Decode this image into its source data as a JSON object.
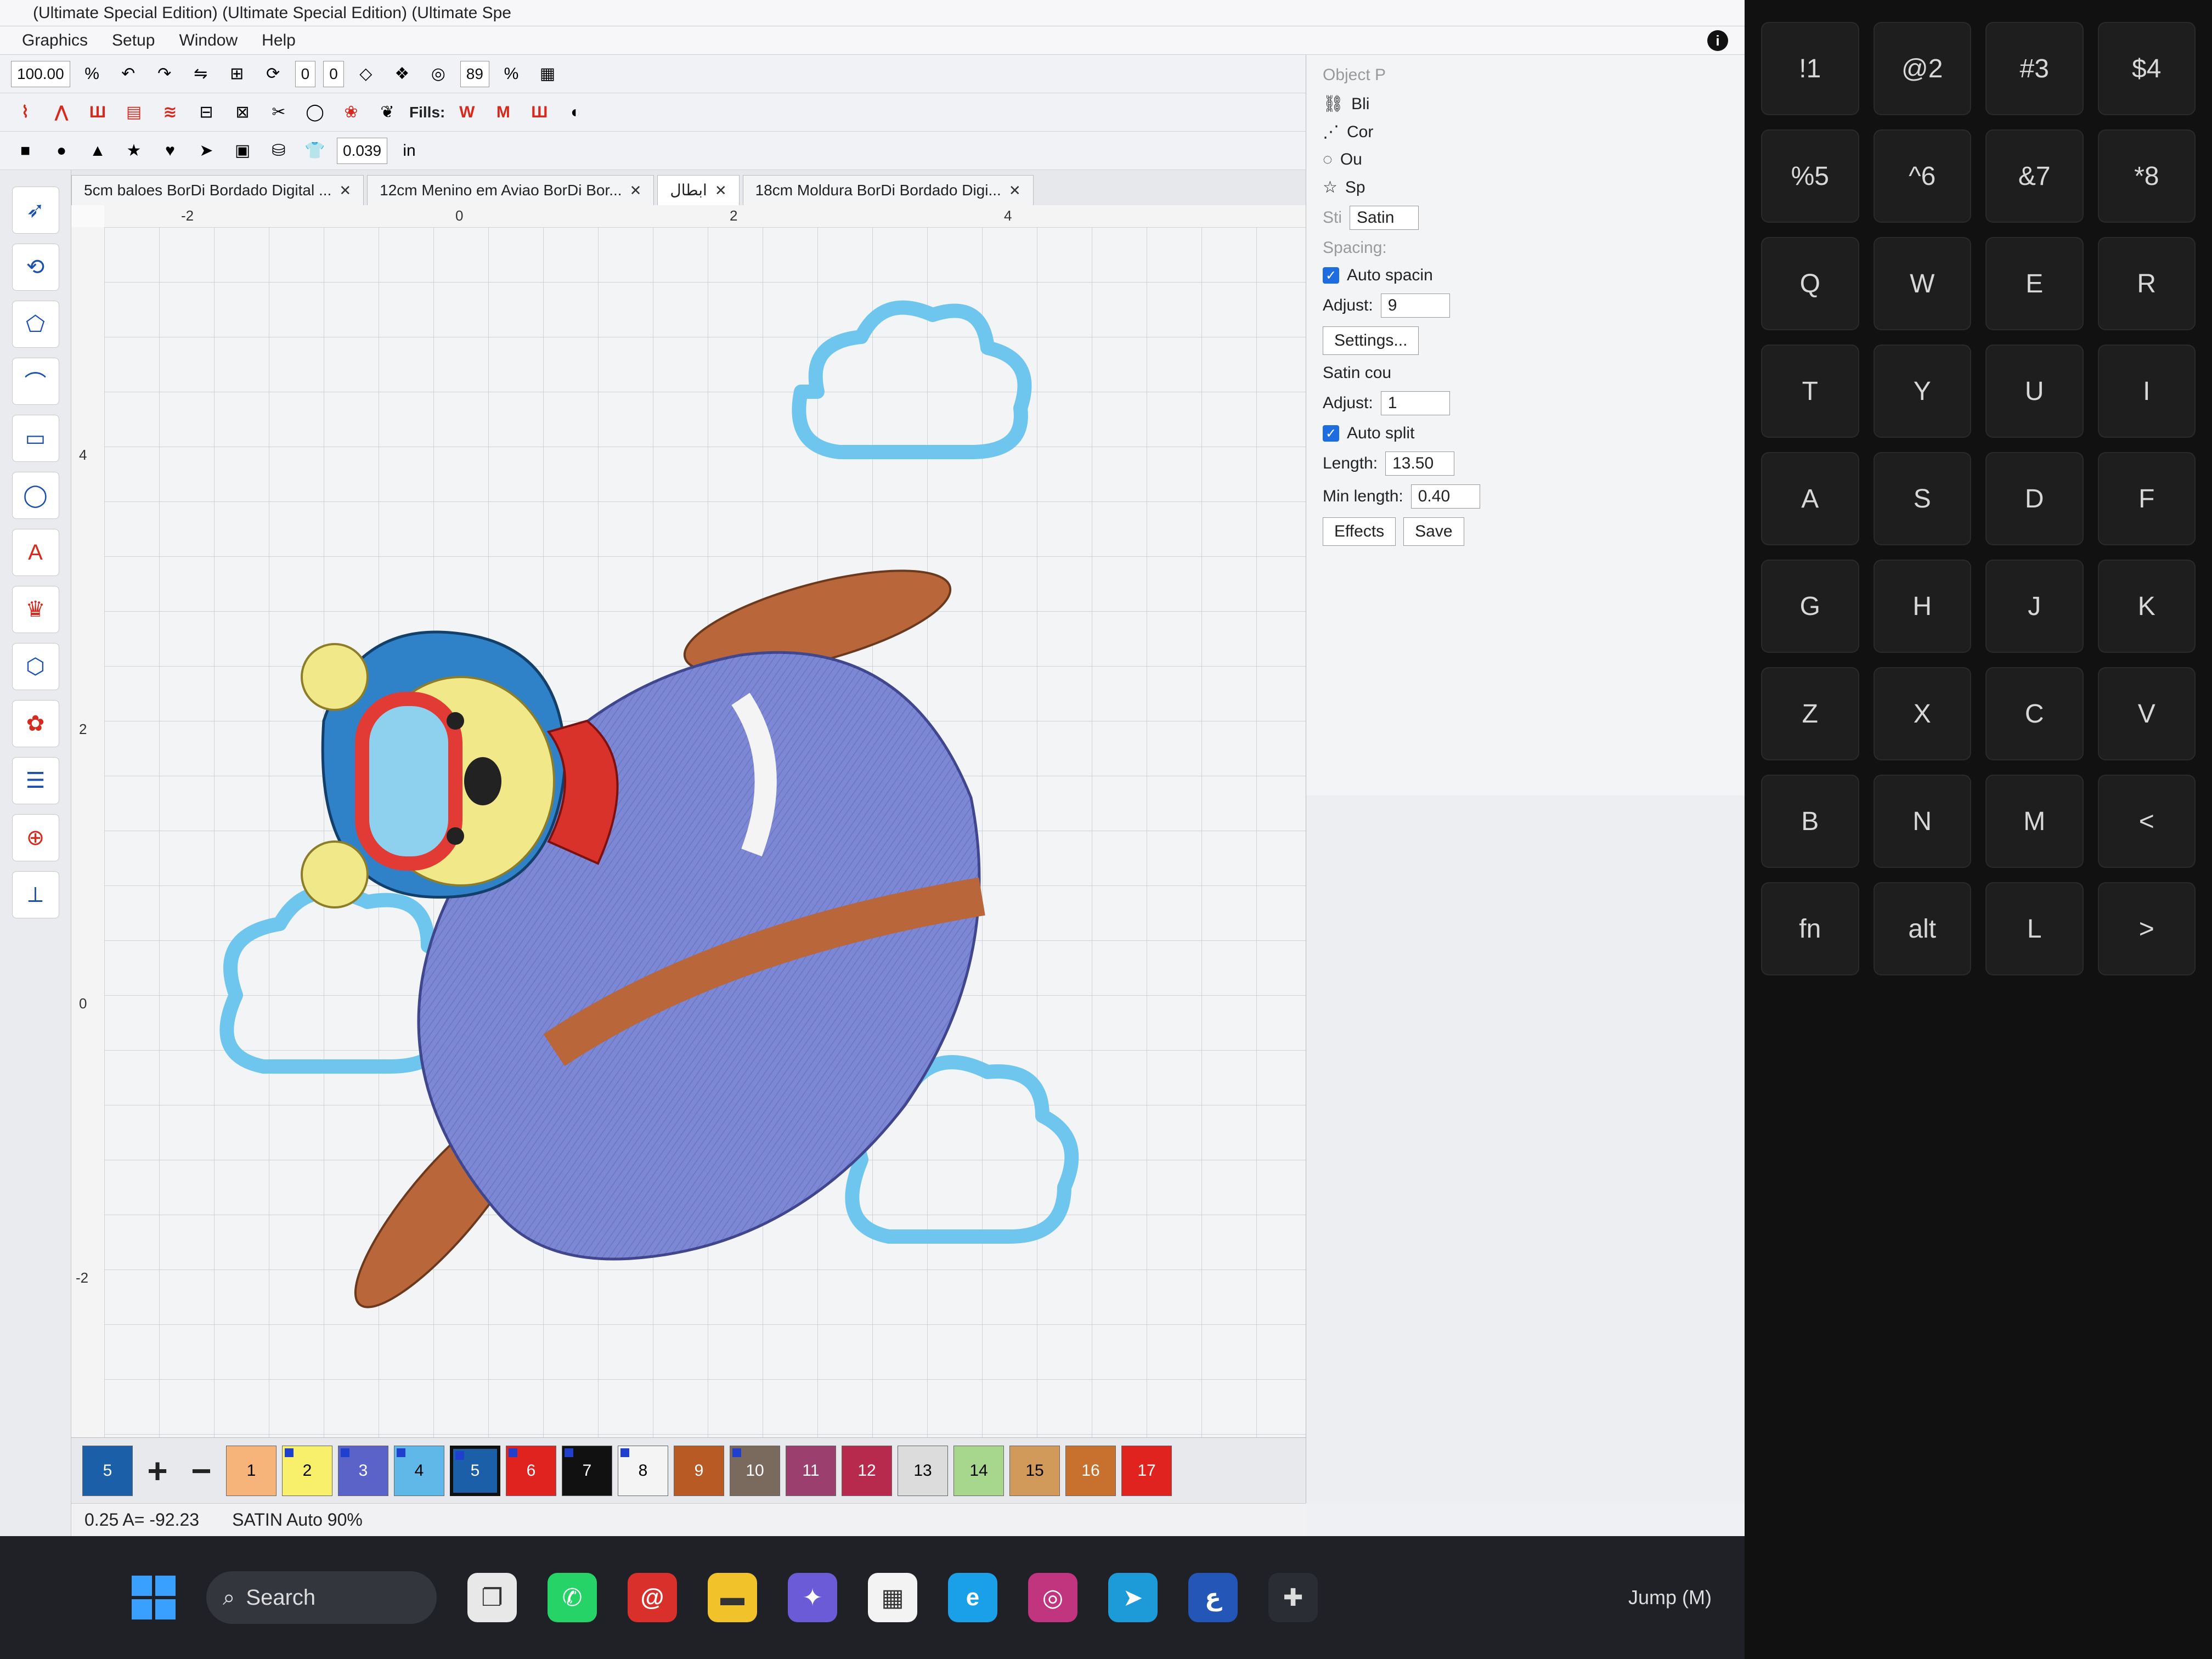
{
  "app": {
    "title": "(Ultimate Special Edition) (Ultimate Special Edition) (Ultimate Spe",
    "menu": [
      "Graphics",
      "Setup",
      "Window",
      "Help"
    ]
  },
  "toolbar": {
    "zoom_value": "100.00",
    "zoom_unit": "%",
    "angle_value": "0",
    "rotation_value": "0",
    "density_value": "89",
    "density_unit": "%",
    "fills_label": "Fills:",
    "width_value": "0.039",
    "width_unit": "in"
  },
  "doc_tabs": [
    {
      "label": "5cm baloes BorDi Bordado Digital ..."
    },
    {
      "label": "12cm Menino em Aviao BorDi Bor..."
    },
    {
      "label": "ابطال"
    },
    {
      "label": "18cm Moldura BorDi Bordado Digi..."
    }
  ],
  "ruler": {
    "top_ticks": [
      "-2",
      "0",
      "2",
      "4"
    ],
    "left_ticks": [
      "-2",
      "0",
      "2",
      "4"
    ]
  },
  "object_properties": {
    "panel_title": "Object P",
    "top_items": [
      "Bli",
      "Cor",
      "Ou",
      "Sp"
    ],
    "stitch_type": "Satin",
    "stitch_label": "Sti",
    "spacing_label": "Spacing:",
    "auto_spacing_label": "Auto spacin",
    "adjust_label": "Adjust:",
    "adjust_value": "9",
    "settings_label": "Settings...",
    "satin_count_label": "Satin cou",
    "adjust2_label": "Adjust:",
    "adjust2_value": "1",
    "auto_split_label": "Auto split",
    "length_label": "Length:",
    "length_value": "13.50",
    "min_length_label": "Min length:",
    "min_length_value": "0.40",
    "save_label": "Save",
    "effects_label": "Effects"
  },
  "colorbar": {
    "swatches": [
      {
        "label": "1",
        "color": "#f6b47a"
      },
      {
        "label": "2",
        "color": "#f8ef6a"
      },
      {
        "label": "3",
        "color": "#5b63c9"
      },
      {
        "label": "4",
        "color": "#5fb8e8"
      },
      {
        "label": "5",
        "color": "#1b5fa8",
        "current": true
      },
      {
        "label": "6",
        "color": "#e0231f"
      },
      {
        "label": "7",
        "color": "#111111"
      },
      {
        "label": "8",
        "color": "#f4f4f4"
      },
      {
        "label": "9",
        "color": "#b85a23"
      },
      {
        "label": "10",
        "color": "#7a6a5e"
      },
      {
        "label": "11",
        "color": "#9a3f6e"
      },
      {
        "label": "12",
        "color": "#b72a4e"
      },
      {
        "label": "13",
        "color": "#dcdcdc"
      },
      {
        "label": "14",
        "color": "#a7d68d"
      },
      {
        "label": "15",
        "color": "#d29a5a"
      },
      {
        "label": "16",
        "color": "#c8702e"
      },
      {
        "label": "17",
        "color": "#e0231f"
      }
    ],
    "current_color_label": "5",
    "plus_label": "+",
    "minus_label": "−"
  },
  "status": {
    "stitch_info": "SATIN Auto 90%",
    "coordinates": "0.25 A= -92.23"
  },
  "taskbar": {
    "search_label": "Search",
    "jump_label": "Jump (M)"
  },
  "keyboard": {
    "keys": [
      "!1",
      "@2",
      "#3",
      "$4",
      "%5",
      "^6",
      "&7",
      "*8",
      "Q",
      "W",
      "E",
      "R",
      "T",
      "Y",
      "U",
      "I",
      "A",
      "S",
      "D",
      "F",
      "G",
      "H",
      "J",
      "K",
      "Z",
      "X",
      "C",
      "V",
      "B",
      "N",
      "M",
      "<",
      "fn",
      "alt",
      "L",
      ">"
    ]
  },
  "design_colors": {
    "cloud": "#6ec5ee",
    "propeller": "#b8663a",
    "plane": "#7c87d6",
    "stripe": "#b8663a",
    "bear_face": "#f1e889",
    "helmet": "#2f82c7",
    "goggle": "#e23a34",
    "scarf": "#d9322b",
    "canvas_grid": "#cfd3d8"
  }
}
